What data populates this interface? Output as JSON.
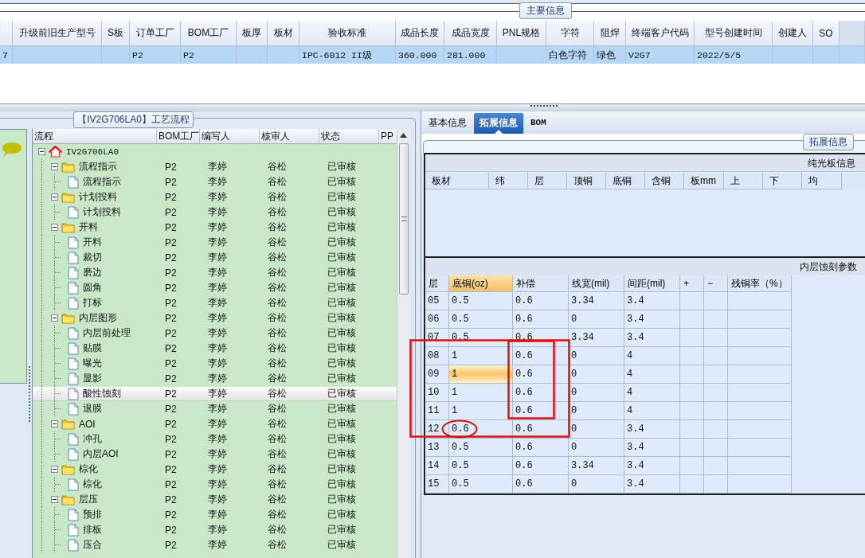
{
  "main_info": {
    "group_title": "主要信息",
    "columns": [
      null,
      "升级前旧生产型号",
      "S板",
      "订单工厂",
      "BOM工厂",
      "板厚",
      "板材",
      "验收标准",
      "成品长度",
      "成品宽度",
      "PNL规格",
      "字符",
      "阻焊",
      "终端客户代码",
      "型号创建时间",
      "创建人",
      "SO"
    ],
    "rows": [
      {
        "selected": true,
        "cells": [
          "7",
          null,
          null,
          "P2",
          "P2",
          null,
          null,
          "IPC-6012 II级",
          "360.000",
          "281.000",
          null,
          "白色字符",
          "绿色",
          "V2G7",
          "2022/5/5",
          null,
          null
        ]
      }
    ]
  },
  "process": {
    "group_title": "【IV2G706LA0】工艺流程",
    "columns": [
      "流程",
      "BOM工厂",
      "编写人",
      "核审人",
      "状态",
      "PP"
    ],
    "tree": [
      {
        "kind": "root",
        "label": "IV2G706LA0",
        "expanded": true,
        "selected": false,
        "children": [
          {
            "kind": "folder",
            "label": "流程指示",
            "bom": "P2",
            "writer": "李婷",
            "reviewer": "谷松",
            "status": "已审核",
            "expanded": true,
            "selected": false,
            "children": [
              {
                "kind": "step",
                "label": "流程指示",
                "bom": "P2",
                "writer": "李婷",
                "reviewer": "谷松",
                "status": "已审核",
                "selected": false
              }
            ]
          },
          {
            "kind": "folder",
            "label": "计划投料",
            "bom": "P2",
            "writer": "李婷",
            "reviewer": "谷松",
            "status": "已审核",
            "expanded": true,
            "selected": false,
            "children": [
              {
                "kind": "step",
                "label": "计划投料",
                "bom": "P2",
                "writer": "李婷",
                "reviewer": "谷松",
                "status": "已审核",
                "selected": false
              }
            ]
          },
          {
            "kind": "folder",
            "label": "开料",
            "bom": "P2",
            "writer": "李婷",
            "reviewer": "谷松",
            "status": "已审核",
            "expanded": true,
            "selected": false,
            "children": [
              {
                "kind": "step",
                "label": "开料",
                "bom": "P2",
                "writer": "李婷",
                "reviewer": "谷松",
                "status": "已审核",
                "selected": false
              },
              {
                "kind": "step",
                "label": "裁切",
                "bom": "P2",
                "writer": "李婷",
                "reviewer": "谷松",
                "status": "已审核",
                "selected": false
              },
              {
                "kind": "step",
                "label": "磨边",
                "bom": "P2",
                "writer": "李婷",
                "reviewer": "谷松",
                "status": "已审核",
                "selected": false
              },
              {
                "kind": "step",
                "label": "圆角",
                "bom": "P2",
                "writer": "李婷",
                "reviewer": "谷松",
                "status": "已审核",
                "selected": false
              },
              {
                "kind": "step",
                "label": "打标",
                "bom": "P2",
                "writer": "李婷",
                "reviewer": "谷松",
                "status": "已审核",
                "selected": false
              }
            ]
          },
          {
            "kind": "folder",
            "label": "内层图形",
            "bom": "P2",
            "writer": "李婷",
            "reviewer": "谷松",
            "status": "已审核",
            "expanded": true,
            "selected": false,
            "children": [
              {
                "kind": "step",
                "label": "内层前处理",
                "bom": "P2",
                "writer": "李婷",
                "reviewer": "谷松",
                "status": "已审核",
                "selected": false
              },
              {
                "kind": "step",
                "label": "贴膜",
                "bom": "P2",
                "writer": "李婷",
                "reviewer": "谷松",
                "status": "已审核",
                "selected": false
              },
              {
                "kind": "step",
                "label": "曝光",
                "bom": "P2",
                "writer": "李婷",
                "reviewer": "谷松",
                "status": "已审核",
                "selected": false
              },
              {
                "kind": "step",
                "label": "显影",
                "bom": "P2",
                "writer": "李婷",
                "reviewer": "谷松",
                "status": "已审核",
                "selected": false
              },
              {
                "kind": "step",
                "label": "酸性蚀刻",
                "bom": "P2",
                "writer": "李婷",
                "reviewer": "谷松",
                "status": "已审核",
                "selected": true
              },
              {
                "kind": "step",
                "label": "退膜",
                "bom": "P2",
                "writer": "李婷",
                "reviewer": "谷松",
                "status": "已审核",
                "selected": false
              }
            ]
          },
          {
            "kind": "folder",
            "label": "AOI",
            "bom": "P2",
            "writer": "李婷",
            "reviewer": "谷松",
            "status": "已审核",
            "expanded": true,
            "selected": false,
            "children": [
              {
                "kind": "step",
                "label": "冲孔",
                "bom": "P2",
                "writer": "李婷",
                "reviewer": "谷松",
                "status": "已审核",
                "selected": false
              },
              {
                "kind": "step",
                "label": "内层AOI",
                "bom": "P2",
                "writer": "李婷",
                "reviewer": "谷松",
                "status": "已审核",
                "selected": false
              }
            ]
          },
          {
            "kind": "folder",
            "label": "棕化",
            "bom": "P2",
            "writer": "李婷",
            "reviewer": "谷松",
            "status": "已审核",
            "expanded": true,
            "selected": false,
            "children": [
              {
                "kind": "step",
                "label": "棕化",
                "bom": "P2",
                "writer": "李婷",
                "reviewer": "谷松",
                "status": "已审核",
                "selected": false
              }
            ]
          },
          {
            "kind": "folder",
            "label": "层压",
            "bom": "P2",
            "writer": "李婷",
            "reviewer": "谷松",
            "status": "已审核",
            "expanded": true,
            "selected": false,
            "children": [
              {
                "kind": "step",
                "label": "预排",
                "bom": "P2",
                "writer": "李婷",
                "reviewer": "谷松",
                "status": "已审核",
                "selected": false
              },
              {
                "kind": "step",
                "label": "排板",
                "bom": "P2",
                "writer": "李婷",
                "reviewer": "谷松",
                "status": "已审核",
                "selected": false
              },
              {
                "kind": "step",
                "label": "压合",
                "bom": "P2",
                "writer": "李婷",
                "reviewer": "谷松",
                "status": "已审核",
                "selected": false
              }
            ]
          }
        ]
      }
    ]
  },
  "detail": {
    "tabs": [
      {
        "label": "基本信息",
        "selected": false
      },
      {
        "label": "拓展信息",
        "selected": true
      },
      {
        "label": "BOM",
        "selected": false
      }
    ],
    "group_title": "拓展信息",
    "plain_board": {
      "title": "纯光板信息",
      "columns": [
        "板材",
        "纬",
        "层",
        "顶铜",
        "底铜",
        "含铜",
        "板mm",
        "上",
        "下",
        "均"
      ]
    },
    "inner_etch": {
      "title": "内层蚀刻参数",
      "columns": [
        {
          "label": "层",
          "selected": false
        },
        {
          "label": "底铜(oz)",
          "selected": true
        },
        {
          "label": "补偿",
          "selected": false
        },
        {
          "label": "线宽(mil)",
          "selected": false
        },
        {
          "label": "间距(mil)",
          "selected": false
        },
        {
          "label": "+",
          "selected": false
        },
        {
          "label": "−",
          "selected": false
        },
        {
          "label": "残铜率（%）",
          "selected": false
        }
      ],
      "rows": [
        {
          "selected": false,
          "cells": [
            "05",
            "0.5",
            "0.6",
            "3.34",
            "3.4",
            null,
            null,
            null
          ]
        },
        {
          "selected": false,
          "cells": [
            "06",
            "0.5",
            "0.6",
            "0",
            "3.4",
            null,
            null,
            null
          ]
        },
        {
          "selected": false,
          "cells": [
            "07",
            "0.5",
            "0.6",
            "3.34",
            "3.4",
            null,
            null,
            null
          ]
        },
        {
          "selected": false,
          "cells": [
            "08",
            "1",
            "0.6",
            "0",
            "4",
            null,
            null,
            null
          ]
        },
        {
          "selected": true,
          "cells": [
            "09",
            "1",
            "0.6",
            "0",
            "4",
            null,
            null,
            null
          ]
        },
        {
          "selected": false,
          "cells": [
            "10",
            "1",
            "0.6",
            "0",
            "4",
            null,
            null,
            null
          ]
        },
        {
          "selected": false,
          "cells": [
            "11",
            "1",
            "0.6",
            "0",
            "4",
            null,
            null,
            null
          ]
        },
        {
          "selected": false,
          "cells": [
            "12",
            "0.6",
            "0.6",
            "0",
            "3.4",
            null,
            null,
            null
          ]
        },
        {
          "selected": false,
          "cells": [
            "13",
            "0.5",
            "0.6",
            "0",
            "3.4",
            null,
            null,
            null
          ]
        },
        {
          "selected": false,
          "cells": [
            "14",
            "0.5",
            "0.6",
            "3.34",
            "3.4",
            null,
            null,
            null
          ]
        },
        {
          "selected": false,
          "cells": [
            "15",
            "0.5",
            "0.6",
            "0",
            "3.4",
            null,
            null,
            null
          ]
        }
      ]
    }
  }
}
